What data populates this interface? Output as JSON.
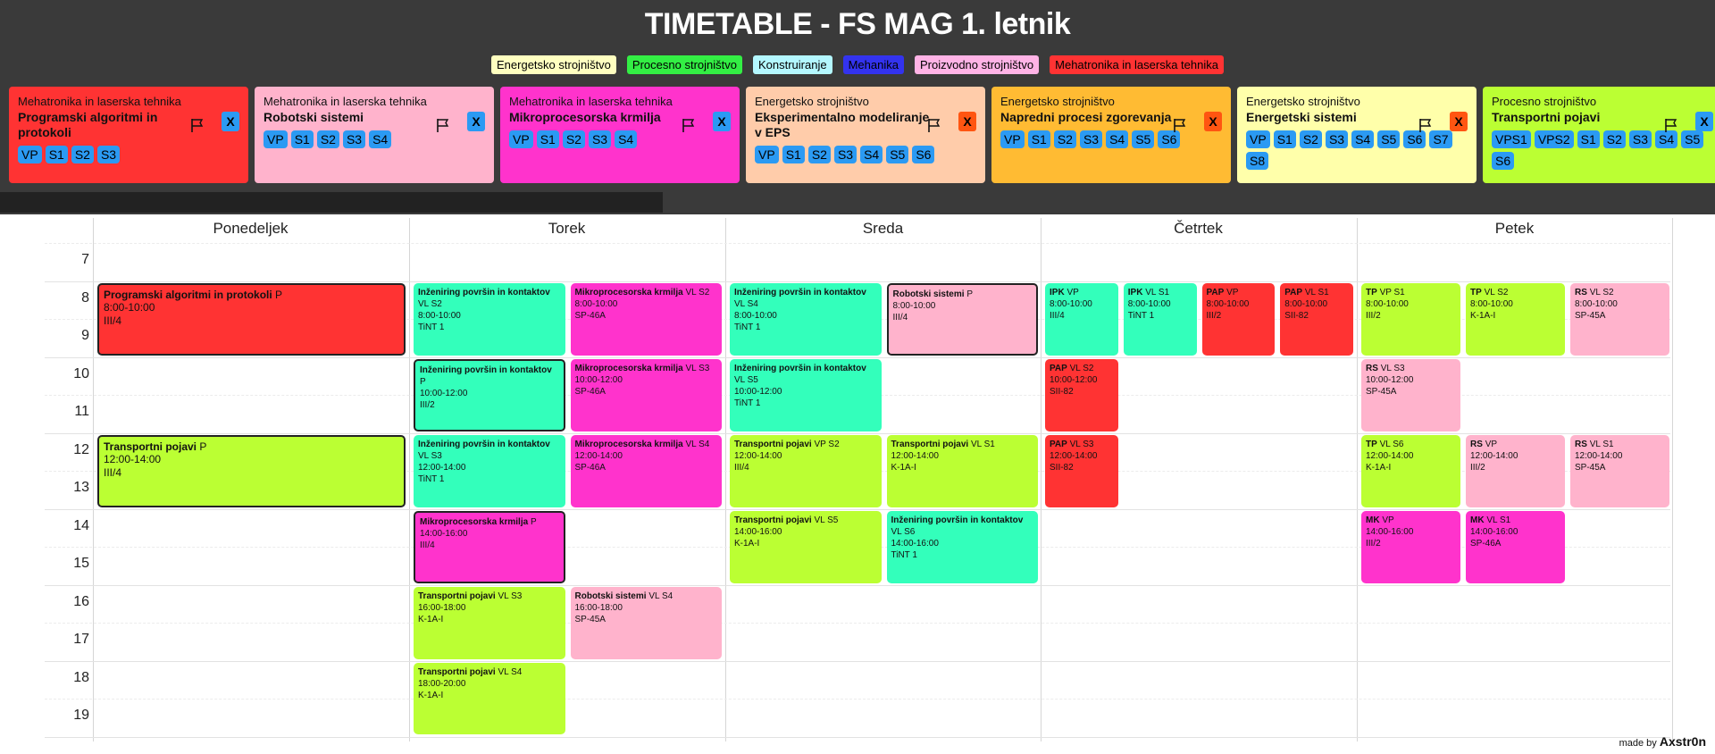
{
  "title": "TIMETABLE - FS MAG 1. letnik",
  "legend": [
    {
      "label": "Energetsko strojništvo",
      "color": "#ffffc0"
    },
    {
      "label": "Procesno strojništvo",
      "color": "#33ee44"
    },
    {
      "label": "Konstruiranje",
      "color": "#b3f7ff"
    },
    {
      "label": "Mehanika",
      "color": "#3333ee"
    },
    {
      "label": "Proizvodno strojništvo",
      "color": "#ffb3e6"
    },
    {
      "label": "Mehatronika in laserska tehnika",
      "color": "#ff3333"
    }
  ],
  "cards": [
    {
      "program": "Mehatronika in laserska tehnika",
      "subject": "Programski algoritmi in protokoli",
      "color": "#ff3333",
      "chips": [
        "VP",
        "S1",
        "S2",
        "S3"
      ],
      "x": "X",
      "x_color": "#2b9af3"
    },
    {
      "program": "Mehatronika in laserska tehnika",
      "subject": "Robotski sistemi",
      "color": "#ffb3cc",
      "chips": [
        "VP",
        "S1",
        "S2",
        "S3",
        "S4"
      ],
      "x": "X",
      "x_color": "#2b9af3"
    },
    {
      "program": "Mehatronika in laserska tehnika",
      "subject": "Mikroprocesorska krmilja",
      "color": "#ff33cc",
      "chips": [
        "VP",
        "S1",
        "S2",
        "S3",
        "S4"
      ],
      "x": "X",
      "x_color": "#2b9af3"
    },
    {
      "program": "Energetsko strojništvo",
      "subject": "Eksperimentalno modeliranje v EPS",
      "color": "#ffccaa",
      "chips": [
        "VP",
        "S1",
        "S2",
        "S3",
        "S4",
        "S5",
        "S6"
      ],
      "x": "X",
      "x_color": "#ff5511"
    },
    {
      "program": "Energetsko strojništvo",
      "subject": "Napredni procesi zgorevanja",
      "color": "#ffbb33",
      "chips": [
        "VP",
        "S1",
        "S2",
        "S3",
        "S4",
        "S5",
        "S6"
      ],
      "x": "X",
      "x_color": "#ff5511"
    },
    {
      "program": "Energetsko strojništvo",
      "subject": "Energetski sistemi",
      "color": "#ffffaa",
      "chips": [
        "VP",
        "S1",
        "S2",
        "S3",
        "S4",
        "S5",
        "S6",
        "S7",
        "S8"
      ],
      "x": "X",
      "x_color": "#ff5511"
    },
    {
      "program": "Procesno strojništvo",
      "subject": "Transportni pojavi",
      "color": "#bbff33",
      "chips": [
        "VPS1",
        "VPS2",
        "S1",
        "S2",
        "S3",
        "S4",
        "S5",
        "S6"
      ],
      "x": "X",
      "x_color": "#2b9af3"
    }
  ],
  "days": [
    "Ponedeljek",
    "Torek",
    "Sreda",
    "Četrtek",
    "Petek"
  ],
  "hours": [
    "7",
    "8",
    "9",
    "10",
    "11",
    "12",
    "13",
    "14",
    "15",
    "16",
    "17",
    "18",
    "19"
  ],
  "events": [
    {
      "day": 0,
      "col": 0,
      "ncols": 1,
      "start": 8,
      "end": 10,
      "name": "Programski algoritmi in protokoli",
      "type": "P",
      "time": "8:00-10:00",
      "room": "III/4",
      "color": "#ff3333",
      "sel": true,
      "big": true
    },
    {
      "day": 0,
      "col": 0,
      "ncols": 1,
      "start": 12,
      "end": 14,
      "name": "Transportni pojavi",
      "type": "P",
      "time": "12:00-14:00",
      "room": "III/4",
      "color": "#bbff33",
      "sel": true,
      "big": true
    },
    {
      "day": 1,
      "col": 0,
      "ncols": 2,
      "start": 8,
      "end": 10,
      "name": "Inženiring površin in kontaktov",
      "type": "VL S2",
      "time": "8:00-10:00",
      "room": "TiNT 1",
      "color": "#33ffbb"
    },
    {
      "day": 1,
      "col": 1,
      "ncols": 2,
      "start": 8,
      "end": 10,
      "name": "Mikroprocesorska krmilja",
      "type": "VL S2",
      "time": "8:00-10:00",
      "room": "SP-46A",
      "color": "#ff33cc"
    },
    {
      "day": 1,
      "col": 0,
      "ncols": 2,
      "start": 10,
      "end": 12,
      "name": "Inženiring površin in kontaktov",
      "type": "P",
      "time": "10:00-12:00",
      "room": "III/2",
      "color": "#33ffbb",
      "sel": true
    },
    {
      "day": 1,
      "col": 1,
      "ncols": 2,
      "start": 10,
      "end": 12,
      "name": "Mikroprocesorska krmilja",
      "type": "VL S3",
      "time": "10:00-12:00",
      "room": "SP-46A",
      "color": "#ff33cc"
    },
    {
      "day": 1,
      "col": 0,
      "ncols": 2,
      "start": 12,
      "end": 14,
      "name": "Inženiring površin in kontaktov",
      "type": "VL S3",
      "time": "12:00-14:00",
      "room": "TiNT 1",
      "color": "#33ffbb"
    },
    {
      "day": 1,
      "col": 1,
      "ncols": 2,
      "start": 12,
      "end": 14,
      "name": "Mikroprocesorska krmilja",
      "type": "VL S4",
      "time": "12:00-14:00",
      "room": "SP-46A",
      "color": "#ff33cc"
    },
    {
      "day": 1,
      "col": 0,
      "ncols": 2,
      "start": 14,
      "end": 16,
      "name": "Mikroprocesorska krmilja",
      "type": "P",
      "time": "14:00-16:00",
      "room": "III/4",
      "color": "#ff33cc",
      "sel": true
    },
    {
      "day": 1,
      "col": 0,
      "ncols": 2,
      "start": 16,
      "end": 18,
      "name": "Transportni pojavi",
      "type": "VL S3",
      "time": "16:00-18:00",
      "room": "K-1A-I",
      "color": "#bbff33"
    },
    {
      "day": 1,
      "col": 1,
      "ncols": 2,
      "start": 16,
      "end": 18,
      "name": "Robotski sistemi",
      "type": "VL S4",
      "time": "16:00-18:00",
      "room": "SP-45A",
      "color": "#ffb3cc"
    },
    {
      "day": 1,
      "col": 0,
      "ncols": 2,
      "start": 18,
      "end": 20,
      "name": "Transportni pojavi",
      "type": "VL S4",
      "time": "18:00-20:00",
      "room": "K-1A-I",
      "color": "#bbff33"
    },
    {
      "day": 2,
      "col": 0,
      "ncols": 2,
      "start": 8,
      "end": 10,
      "name": "Inženiring površin in kontaktov",
      "type": "VL S4",
      "time": "8:00-10:00",
      "room": "TiNT 1",
      "color": "#33ffbb"
    },
    {
      "day": 2,
      "col": 1,
      "ncols": 2,
      "start": 8,
      "end": 10,
      "name": "Robotski sistemi",
      "type": "P",
      "time": "8:00-10:00",
      "room": "III/4",
      "color": "#ffb3cc",
      "sel": true
    },
    {
      "day": 2,
      "col": 0,
      "ncols": 2,
      "start": 10,
      "end": 12,
      "name": "Inženiring površin in kontaktov",
      "type": "VL S5",
      "time": "10:00-12:00",
      "room": "TiNT 1",
      "color": "#33ffbb"
    },
    {
      "day": 2,
      "col": 0,
      "ncols": 2,
      "start": 12,
      "end": 14,
      "name": "Transportni pojavi",
      "type": "VP S2",
      "time": "12:00-14:00",
      "room": "III/4",
      "color": "#bbff33"
    },
    {
      "day": 2,
      "col": 1,
      "ncols": 2,
      "start": 12,
      "end": 14,
      "name": "Transportni pojavi",
      "type": "VL S1",
      "time": "12:00-14:00",
      "room": "K-1A-I",
      "color": "#bbff33"
    },
    {
      "day": 2,
      "col": 0,
      "ncols": 2,
      "start": 14,
      "end": 16,
      "name": "Transportni pojavi",
      "type": "VL S5",
      "time": "14:00-16:00",
      "room": "K-1A-I",
      "color": "#bbff33"
    },
    {
      "day": 2,
      "col": 1,
      "ncols": 2,
      "start": 14,
      "end": 16,
      "name": "Inženiring površin in kontaktov",
      "type": "VL S6",
      "time": "14:00-16:00",
      "room": "TiNT 1",
      "color": "#33ffbb"
    },
    {
      "day": 3,
      "col": 0,
      "ncols": 4,
      "start": 8,
      "end": 10,
      "name": "IPK",
      "type": "VP",
      "time": "8:00-10:00",
      "room": "III/4",
      "color": "#33ffbb"
    },
    {
      "day": 3,
      "col": 1,
      "ncols": 4,
      "start": 8,
      "end": 10,
      "name": "IPK",
      "type": "VL S1",
      "time": "8:00-10:00",
      "room": "TiNT 1",
      "color": "#33ffbb"
    },
    {
      "day": 3,
      "col": 2,
      "ncols": 4,
      "start": 8,
      "end": 10,
      "name": "PAP",
      "type": "VP",
      "time": "8:00-10:00",
      "room": "III/2",
      "color": "#ff3333"
    },
    {
      "day": 3,
      "col": 3,
      "ncols": 4,
      "start": 8,
      "end": 10,
      "name": "PAP",
      "type": "VL S1",
      "time": "8:00-10:00",
      "room": "SII-82",
      "color": "#ff3333"
    },
    {
      "day": 3,
      "col": 0,
      "ncols": 4,
      "start": 10,
      "end": 12,
      "name": "PAP",
      "type": "VL S2",
      "time": "10:00-12:00",
      "room": "SII-82",
      "color": "#ff3333"
    },
    {
      "day": 3,
      "col": 0,
      "ncols": 4,
      "start": 12,
      "end": 14,
      "name": "PAP",
      "type": "VL S3",
      "time": "12:00-14:00",
      "room": "SII-82",
      "color": "#ff3333"
    },
    {
      "day": 4,
      "col": 0,
      "ncols": 3,
      "start": 8,
      "end": 10,
      "name": "TP",
      "type": "VP S1",
      "time": "8:00-10:00",
      "room": "III/2",
      "color": "#bbff33"
    },
    {
      "day": 4,
      "col": 1,
      "ncols": 3,
      "start": 8,
      "end": 10,
      "name": "TP",
      "type": "VL S2",
      "time": "8:00-10:00",
      "room": "K-1A-I",
      "color": "#bbff33"
    },
    {
      "day": 4,
      "col": 2,
      "ncols": 3,
      "start": 8,
      "end": 10,
      "name": "RS",
      "type": "VL S2",
      "time": "8:00-10:00",
      "room": "SP-45A",
      "color": "#ffb3cc"
    },
    {
      "day": 4,
      "col": 0,
      "ncols": 3,
      "start": 10,
      "end": 12,
      "name": "RS",
      "type": "VL S3",
      "time": "10:00-12:00",
      "room": "SP-45A",
      "color": "#ffb3cc"
    },
    {
      "day": 4,
      "col": 0,
      "ncols": 3,
      "start": 12,
      "end": 14,
      "name": "TP",
      "type": "VL S6",
      "time": "12:00-14:00",
      "room": "K-1A-I",
      "color": "#bbff33"
    },
    {
      "day": 4,
      "col": 1,
      "ncols": 3,
      "start": 12,
      "end": 14,
      "name": "RS",
      "type": "VP",
      "time": "12:00-14:00",
      "room": "III/2",
      "color": "#ffb3cc"
    },
    {
      "day": 4,
      "col": 2,
      "ncols": 3,
      "start": 12,
      "end": 14,
      "name": "RS",
      "type": "VL S1",
      "time": "12:00-14:00",
      "room": "SP-45A",
      "color": "#ffb3cc"
    },
    {
      "day": 4,
      "col": 0,
      "ncols": 3,
      "start": 14,
      "end": 16,
      "name": "MK",
      "type": "VP",
      "time": "14:00-16:00",
      "room": "III/2",
      "color": "#ff33cc"
    },
    {
      "day": 4,
      "col": 1,
      "ncols": 3,
      "start": 14,
      "end": 16,
      "name": "MK",
      "type": "VL S1",
      "time": "14:00-16:00",
      "room": "SP-46A",
      "color": "#ff33cc"
    }
  ],
  "footer": {
    "made_by": "made by",
    "author": "Axstr0n"
  }
}
